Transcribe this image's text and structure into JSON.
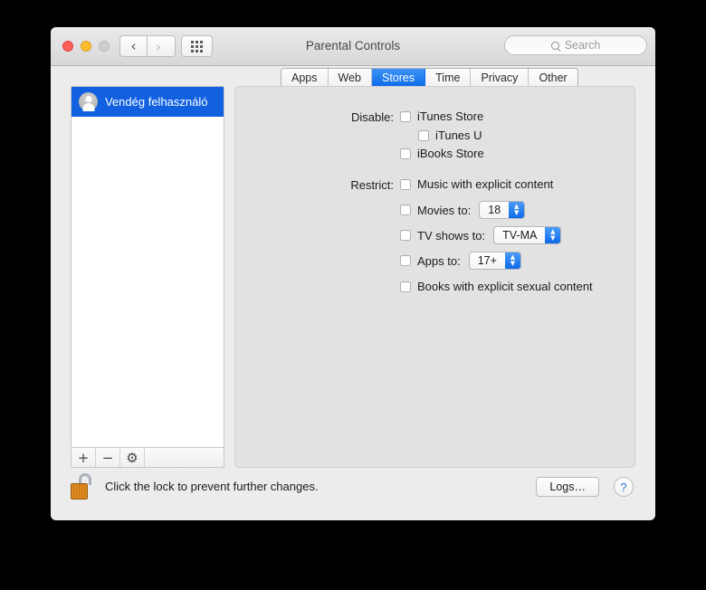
{
  "window": {
    "title": "Parental Controls",
    "traffic_lights": [
      "close",
      "minimize",
      "zoom-disabled"
    ],
    "nav": {
      "back": "‹",
      "forward": "›"
    },
    "grid_button": "show-all-preferences"
  },
  "search": {
    "placeholder": "Search",
    "value": ""
  },
  "sidebar": {
    "users": [
      {
        "name": "Vendég felhasználó",
        "selected": true
      }
    ],
    "toolbar": {
      "add": "+",
      "remove": "−",
      "settings": "⚙"
    }
  },
  "tabs": [
    {
      "label": "Apps",
      "active": false
    },
    {
      "label": "Web",
      "active": false
    },
    {
      "label": "Stores",
      "active": true
    },
    {
      "label": "Time",
      "active": false
    },
    {
      "label": "Privacy",
      "active": false
    },
    {
      "label": "Other",
      "active": false
    }
  ],
  "panel": {
    "disable_label": "Disable:",
    "restrict_label": "Restrict:",
    "disable_items": [
      {
        "label": "iTunes Store",
        "checked": false
      },
      {
        "label": "iTunes U",
        "checked": false
      },
      {
        "label": "iBooks Store",
        "checked": false
      }
    ],
    "restrict_items": [
      {
        "label": "Music with explicit content",
        "checked": false
      },
      {
        "label": "Movies to:",
        "checked": false,
        "value": "18"
      },
      {
        "label": "TV shows to:",
        "checked": false,
        "value": "TV-MA"
      },
      {
        "label": "Apps to:",
        "checked": false,
        "value": "17+"
      },
      {
        "label": "Books with explicit sexual content",
        "checked": false
      }
    ]
  },
  "footer": {
    "lock_text": "Click the lock to prevent further changes.",
    "lock_state": "unlocked",
    "logs_label": "Logs…",
    "help_label": "?"
  },
  "colors": {
    "accent_blue": "#1060e0",
    "tab_active": "#0a6ae8",
    "window_bg": "#ececec",
    "panel_bg": "#e2e2e2",
    "lock_orange": "#e08a1e"
  }
}
